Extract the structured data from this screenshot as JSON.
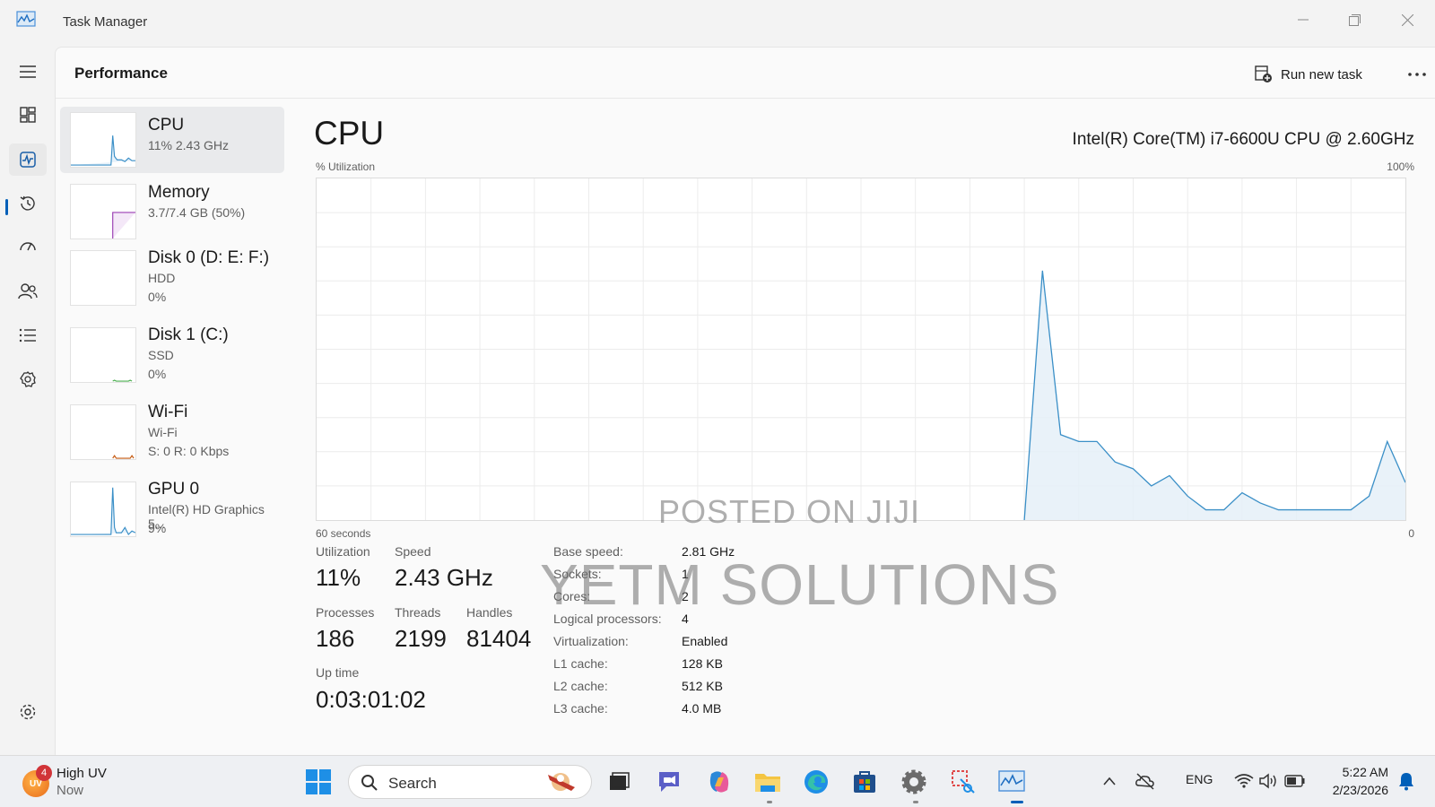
{
  "window": {
    "title": "Task Manager"
  },
  "header": {
    "title": "Performance",
    "run_task_label": "Run new task"
  },
  "nav": [
    "menu-icon",
    "processes-icon",
    "performance-icon",
    "app-history-icon",
    "startup-icon",
    "users-icon",
    "details-icon",
    "services-icon",
    "settings-icon"
  ],
  "resources": [
    {
      "name": "CPU",
      "line1": "11%  2.43 GHz",
      "line2": "",
      "color": "#3a8fc7"
    },
    {
      "name": "Memory",
      "line1": "3.7/7.4 GB (50%)",
      "line2": "",
      "color": "#9b3fb4"
    },
    {
      "name": "Disk 0 (D: E: F:)",
      "line1": "HDD",
      "line2": "0%",
      "color": "#4caf50"
    },
    {
      "name": "Disk 1 (C:)",
      "line1": "SSD",
      "line2": "0%",
      "color": "#4caf50"
    },
    {
      "name": "Wi-Fi",
      "line1": "Wi-Fi",
      "line2": "S: 0  R: 0 Kbps",
      "color": "#c55a11"
    },
    {
      "name": "GPU 0",
      "line1": "Intel(R) HD Graphics 5...",
      "line2": "9%",
      "color": "#3a8fc7"
    }
  ],
  "detail": {
    "title": "CPU",
    "model": "Intel(R) Core(TM) i7-6600U CPU @ 2.60GHz",
    "util_label": "% Utilization",
    "util_max": "100%",
    "x_left": "60 seconds",
    "x_right": "0"
  },
  "stats": {
    "utilization_label": "Utilization",
    "utilization": "11%",
    "speed_label": "Speed",
    "speed": "2.43 GHz",
    "processes_label": "Processes",
    "processes": "186",
    "threads_label": "Threads",
    "threads": "2199",
    "handles_label": "Handles",
    "handles": "81404",
    "uptime_label": "Up time",
    "uptime": "0:03:01:02"
  },
  "specs": [
    {
      "k": "Base speed:",
      "v": "2.81 GHz"
    },
    {
      "k": "Sockets:",
      "v": "1"
    },
    {
      "k": "Cores:",
      "v": "2"
    },
    {
      "k": "Logical processors:",
      "v": "4"
    },
    {
      "k": "Virtualization:",
      "v": "Enabled"
    },
    {
      "k": "L1 cache:",
      "v": "128 KB"
    },
    {
      "k": "L2 cache:",
      "v": "512 KB"
    },
    {
      "k": "L3 cache:",
      "v": "4.0 MB"
    }
  ],
  "chart_data": {
    "type": "area",
    "xlabel": "60 seconds",
    "ylabel": "% Utilization",
    "ylim": [
      0,
      100
    ],
    "x": [
      0,
      1,
      2,
      3,
      4,
      5,
      6,
      7,
      8,
      9,
      10,
      11,
      12,
      13,
      14,
      15,
      16,
      17,
      18,
      19,
      20,
      21,
      22,
      23,
      24,
      25,
      26,
      27,
      28,
      29,
      30,
      31,
      32,
      33,
      34,
      35,
      36,
      37,
      38,
      39,
      40,
      41,
      42,
      43,
      44,
      45,
      46,
      47,
      48,
      49,
      50,
      51,
      52,
      53,
      54,
      55,
      56,
      57,
      58,
      59,
      60
    ],
    "series": [
      {
        "values": [
          null,
          null,
          null,
          null,
          null,
          null,
          null,
          null,
          null,
          null,
          null,
          null,
          null,
          null,
          null,
          null,
          null,
          null,
          null,
          null,
          null,
          null,
          null,
          null,
          null,
          null,
          null,
          null,
          null,
          null,
          null,
          null,
          null,
          null,
          null,
          null,
          null,
          null,
          null,
          0,
          73,
          25,
          23,
          23,
          17,
          15,
          10,
          13,
          7,
          3,
          3,
          8,
          5,
          3,
          3,
          3,
          3,
          3,
          7,
          23,
          11
        ],
        "color": "#3a8fc7"
      }
    ],
    "grid": true
  },
  "watermark": {
    "line1": "POSTED ON JIJI",
    "line2": "YETM SOLUTIONS"
  },
  "taskbar": {
    "weather_title": "High UV",
    "weather_sub": "Now",
    "weather_badge": "4",
    "weather_avatar": "UV",
    "search_placeholder": "Search",
    "lang": "ENG",
    "time": "5:22 AM",
    "date": "2/23/2026"
  }
}
